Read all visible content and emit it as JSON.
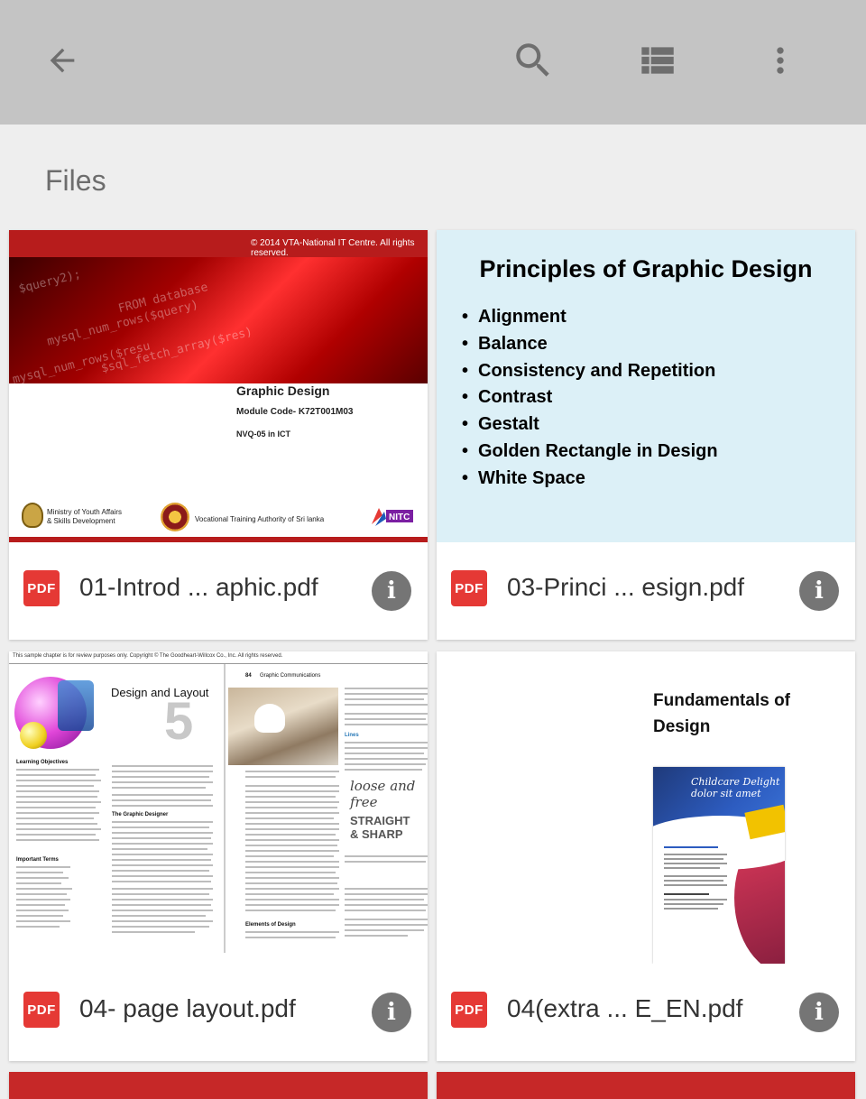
{
  "appbar": {
    "back_icon": "arrow-back-icon",
    "search_icon": "search-icon",
    "view_icon": "list-view-icon",
    "more_icon": "more-vert-icon",
    "background": "#c4c4c4"
  },
  "section": {
    "title": "Files"
  },
  "files": [
    {
      "name": "01-Introd ... aphic.pdf",
      "type_badge": "PDF",
      "info_glyph": "i",
      "thumb": {
        "copyright": "© 2014 VTA-National IT Centre. All rights reserved.",
        "code_lines": [
          "$query2);",
          "FROM database",
          "mysql_num_rows($query)",
          "$sql_fetch_array($res)",
          "mysql_num_rows($resu"
        ],
        "title": "Graphic Design",
        "module_code": "Module Code- K72T001M03",
        "nvq": "NVQ-05 in ICT",
        "logo1_text_1": "Ministry of Youth Affairs",
        "logo1_text_2": "& Skills Development",
        "logo2_text": "Vocational Training Authority of Sri lanka",
        "logo3_text": "NITC"
      }
    },
    {
      "name": "03-Princi ... esign.pdf",
      "type_badge": "PDF",
      "info_glyph": "i",
      "thumb": {
        "title": "Principles of Graphic Design",
        "bullets": [
          "Alignment",
          "Balance",
          "Consistency and Repetition",
          "Contrast",
          "Gestalt",
          "Golden Rectangle in Design",
          "White Space"
        ]
      }
    },
    {
      "name": "04- page layout.pdf",
      "type_badge": "PDF",
      "info_glyph": "i",
      "thumb": {
        "header": "This sample chapter is for review purposes only. Copyright © The Goodheart-Willcox Co., Inc. All rights reserved.",
        "chapter_title": "Design and Layout",
        "chapter_number": "5",
        "page_num": "84",
        "running_head": "Graphic Communications",
        "learning_objectives": "Learning Objectives",
        "important_terms": "Important Terms",
        "graphic_designer": "The Graphic Designer",
        "elements_of_design": "Elements of Design",
        "lines": "Lines",
        "script_1": "loose and",
        "script_2": "free",
        "straight_1": "STRAIGHT",
        "straight_2": "& SHARP"
      }
    },
    {
      "name": "04(extra ... E_EN.pdf",
      "type_badge": "PDF",
      "info_glyph": "i",
      "thumb": {
        "title_1": "Fundamentals of",
        "title_2": "Design",
        "flyer_1": "Childcare Delight",
        "flyer_2": "dolor sit amet"
      }
    }
  ],
  "colors": {
    "pdf_badge": "#e53935",
    "info_button": "#757575",
    "slide_bg": "#dcf0f7"
  }
}
